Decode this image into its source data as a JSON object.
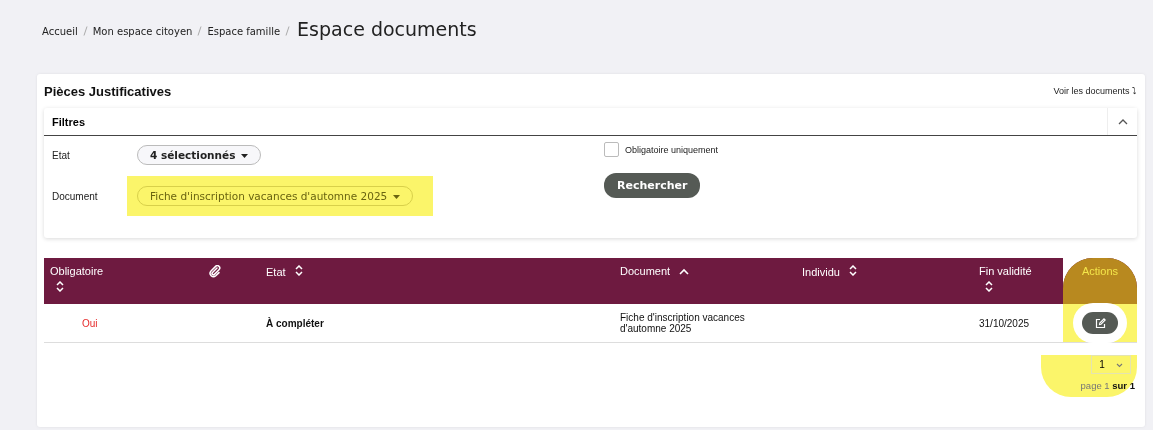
{
  "breadcrumb": [
    "Accueil",
    "Mon espace citoyen",
    "Espace famille"
  ],
  "page_title": "Espace documents",
  "card": {
    "title": "Pièces Justificatives",
    "link": "Voir les documents ⤵"
  },
  "filters": {
    "title": "Filtres",
    "expanded": true,
    "fields": [
      {
        "label": "Etat",
        "value": "4 sélectionnés",
        "highlighted": false
      },
      {
        "label": "Document",
        "value": "Fiche d'inscription vacances d'automne 2025",
        "highlighted": true
      }
    ],
    "checkbox": {
      "label": "Obligatoire uniquement",
      "checked": false
    },
    "button": "Rechercher"
  },
  "table": {
    "columns": [
      {
        "kind": "text",
        "label": "Obligatoire",
        "sortable": true,
        "sorted": false,
        "highlighted": false
      },
      {
        "kind": "icon",
        "sortable": false,
        "sorted": false,
        "highlighted": false
      },
      {
        "kind": "text",
        "label": "Etat",
        "sortable": true,
        "sorted": false,
        "highlighted": false
      },
      {
        "kind": "text",
        "label": "Document",
        "sortable": true,
        "sorted": true,
        "highlighted": false
      },
      {
        "kind": "text",
        "label": "Individu",
        "sortable": true,
        "sorted": false,
        "highlighted": false
      },
      {
        "kind": "text",
        "label": "Fin validité",
        "sortable": true,
        "sorted": false,
        "highlighted": false
      },
      {
        "kind": "text",
        "label": "Actions",
        "sortable": false,
        "sorted": false,
        "highlighted": true
      }
    ],
    "rows": [
      {
        "mandatory": "Oui",
        "state": "À compléter",
        "document": "Fiche d'inscription vacances d'automne 2025",
        "end_date": "31/10/2025"
      }
    ]
  },
  "pagination": {
    "page_select": "1",
    "text": "page 1 **sur 1**"
  }
}
